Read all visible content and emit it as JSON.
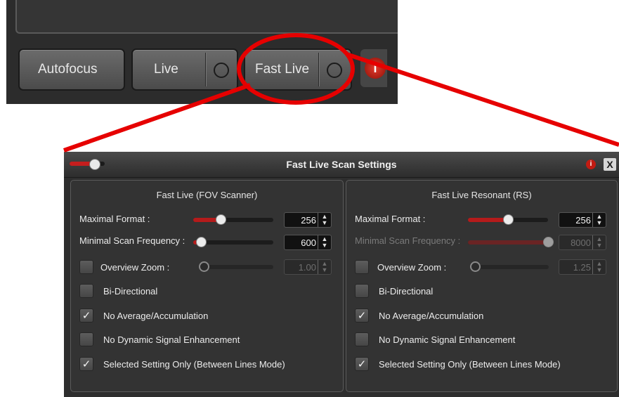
{
  "toolbar": {
    "autofocus_label": "Autofocus",
    "live_label": "Live",
    "fast_live_label": "Fast Live",
    "info_icon": "info-icon"
  },
  "dialog": {
    "title": "Fast Live Scan Settings",
    "close_label": "X",
    "info_label": "i",
    "fov": {
      "title": "Fast Live (FOV Scanner)",
      "maximal_format_label": "Maximal Format :",
      "maximal_format_value": "256",
      "maximal_format_level": 0.34,
      "min_scan_freq_label": "Minimal Scan Frequency :",
      "min_scan_freq_value": "600",
      "min_scan_freq_level": 0.1,
      "overview_zoom_label": "Overview Zoom :",
      "overview_zoom_value": "1.00",
      "overview_zoom_checked": false,
      "bidirectional_label": "Bi-Directional",
      "bidirectional_checked": false,
      "no_average_label": "No Average/Accumulation",
      "no_average_checked": true,
      "no_dse_label": "No Dynamic Signal Enhancement",
      "no_dse_checked": false,
      "selected_only_label": "Selected Setting Only (Between Lines Mode)",
      "selected_only_checked": true
    },
    "rs": {
      "title": "Fast Live Resonant (RS)",
      "maximal_format_label": "Maximal Format :",
      "maximal_format_value": "256",
      "maximal_format_level": 0.5,
      "min_scan_freq_label": "Minimal Scan Frequency :",
      "min_scan_freq_value": "8000",
      "min_scan_freq_level": 1.0,
      "overview_zoom_label": "Overview Zoom :",
      "overview_zoom_value": "1.25",
      "overview_zoom_checked": false,
      "bidirectional_label": "Bi-Directional",
      "bidirectional_checked": false,
      "no_average_label": "No Average/Accumulation",
      "no_average_checked": true,
      "no_dse_label": "No Dynamic Signal Enhancement",
      "no_dse_checked": false,
      "selected_only_label": "Selected Setting Only (Between Lines Mode)",
      "selected_only_checked": true
    }
  },
  "colors": {
    "accent_red": "#c41e1e",
    "callout_red": "#e60000",
    "panel_bg": "#333333"
  }
}
